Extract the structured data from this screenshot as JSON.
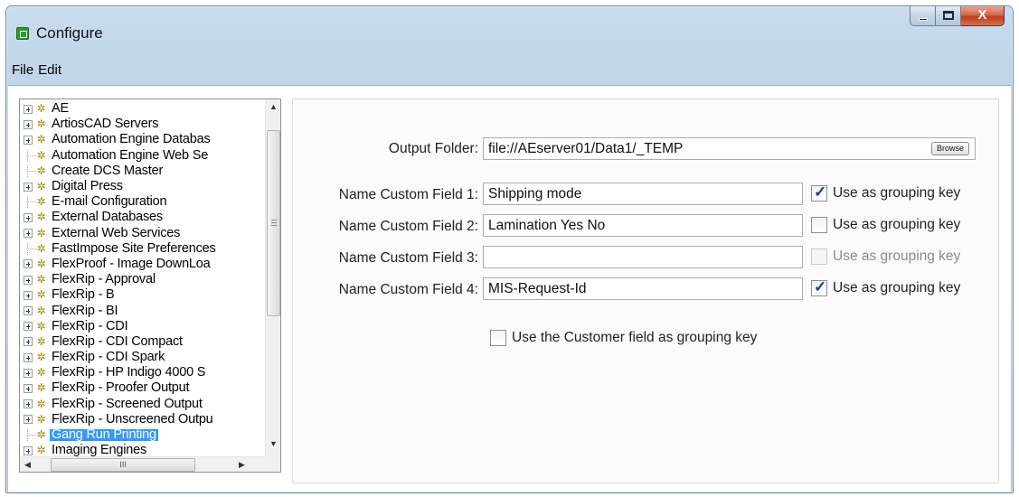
{
  "window": {
    "title": "Configure"
  },
  "menu": [
    "File",
    "Edit"
  ],
  "tree": {
    "items": [
      {
        "label": "AE",
        "expandable": true
      },
      {
        "label": "ArtiosCAD Servers",
        "expandable": true
      },
      {
        "label": "Automation Engine Databas",
        "expandable": true
      },
      {
        "label": "Automation Engine Web Se",
        "expandable": false
      },
      {
        "label": "Create DCS Master",
        "expandable": false
      },
      {
        "label": "Digital Press",
        "expandable": true
      },
      {
        "label": "E-mail Configuration",
        "expandable": false
      },
      {
        "label": "External Databases",
        "expandable": true
      },
      {
        "label": "External Web Services",
        "expandable": true
      },
      {
        "label": "FastImpose Site Preferences",
        "expandable": false
      },
      {
        "label": "FlexProof - Image DownLoa",
        "expandable": true
      },
      {
        "label": "FlexRip - Approval",
        "expandable": true
      },
      {
        "label": "FlexRip - B",
        "expandable": true
      },
      {
        "label": "FlexRip - BI",
        "expandable": true
      },
      {
        "label": "FlexRip - CDI",
        "expandable": true
      },
      {
        "label": "FlexRip - CDI Compact",
        "expandable": true
      },
      {
        "label": "FlexRip - CDI Spark",
        "expandable": true
      },
      {
        "label": "FlexRip - HP Indigo 4000 S",
        "expandable": true
      },
      {
        "label": "FlexRip - Proofer Output",
        "expandable": true
      },
      {
        "label": "FlexRip - Screened Output",
        "expandable": true
      },
      {
        "label": "FlexRip - Unscreened Outpu",
        "expandable": true
      },
      {
        "label": "Gang Run Printing",
        "expandable": false,
        "selected": true
      },
      {
        "label": "Imaging Engines",
        "expandable": true
      }
    ],
    "hscroll_grip": "III"
  },
  "form": {
    "output_folder": {
      "label": "Output Folder:",
      "value": "file://AEserver01/Data1/_TEMP",
      "browse_label": "Browse"
    },
    "custom_fields": [
      {
        "label": "Name Custom Field 1:",
        "value": "Shipping mode",
        "grouping_checked": true,
        "grouping_enabled": true,
        "grouping_label": "Use as grouping key"
      },
      {
        "label": "Name Custom Field 2:",
        "value": "Lamination Yes No",
        "grouping_checked": false,
        "grouping_enabled": true,
        "grouping_label": "Use as grouping key"
      },
      {
        "label": "Name Custom Field 3:",
        "value": "",
        "grouping_checked": false,
        "grouping_enabled": false,
        "grouping_label": "Use as grouping key"
      },
      {
        "label": "Name Custom Field 4:",
        "value": "MIS-Request-Id",
        "grouping_checked": true,
        "grouping_enabled": true,
        "grouping_label": "Use as grouping key"
      }
    ],
    "customer_grouping": {
      "label": "Use the Customer field as grouping key",
      "checked": false
    }
  }
}
